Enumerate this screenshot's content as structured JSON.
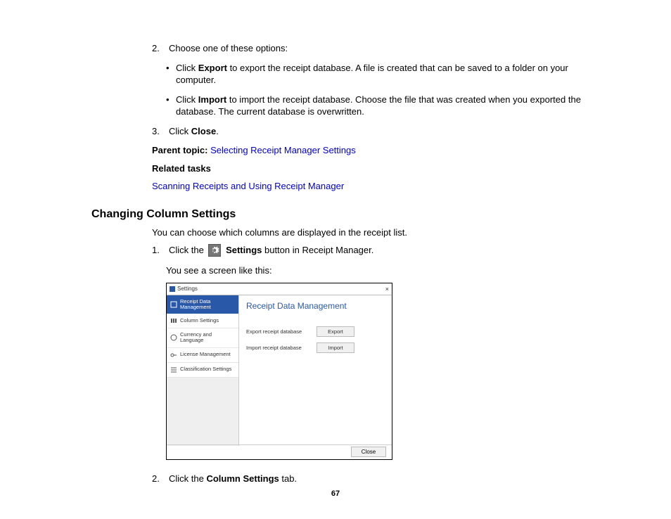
{
  "step2": {
    "num": "2.",
    "text_a": "Choose one of these options:",
    "bullet1_pre": "Click ",
    "bullet1_bold": "Export",
    "bullet1_post": " to export the receipt database. A file is created that can be saved to a folder on your computer.",
    "bullet2_pre": "Click ",
    "bullet2_bold": "Import",
    "bullet2_post": " to import the receipt database. Choose the file that was created when you exported the database. The current database is overwritten."
  },
  "step3": {
    "num": "3.",
    "pre": "Click ",
    "bold": "Close",
    "post": "."
  },
  "parent_topic_label": "Parent topic: ",
  "parent_topic_link": "Selecting Receipt Manager Settings",
  "related_tasks_label": "Related tasks",
  "related_link": "Scanning Receipts and Using Receipt Manager",
  "section_heading": "Changing Column Settings",
  "section_intro": "You can choose which columns are displayed in the receipt list.",
  "cs_step1": {
    "num": "1.",
    "pre": "Click the ",
    "bold": " Settings",
    "post": " button in Receipt Manager.",
    "note": "You see a screen like this:"
  },
  "cs_step2": {
    "num": "2.",
    "pre": "Click the ",
    "bold": "Column Settings",
    "post": " tab."
  },
  "shot": {
    "title": "Settings",
    "close": "×",
    "side": {
      "item0": "Receipt Data Management",
      "item1": "Column Settings",
      "item2": "Currency and Language",
      "item3": "License Management",
      "item4": "Classification Settings"
    },
    "heading": "Receipt Data Management",
    "row1_label": "Export receipt database",
    "row1_btn": "Export",
    "row2_label": "Import receipt database",
    "row2_btn": "Import",
    "close_btn": "Close"
  },
  "page_number": "67"
}
